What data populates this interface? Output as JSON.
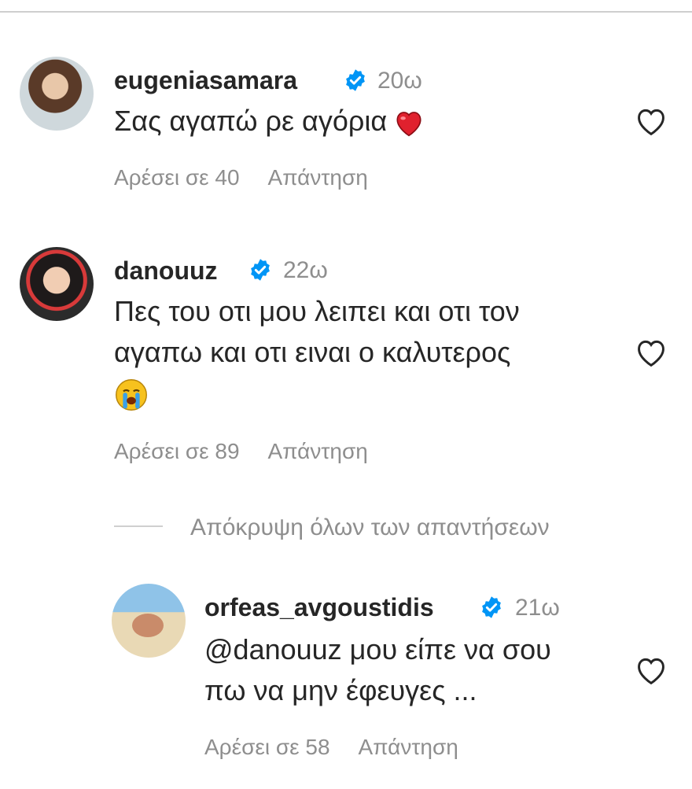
{
  "comments": [
    {
      "username": "eugeniasamara",
      "time": "20ω",
      "text": "Σας αγαπώ ρε αγόρια",
      "emoji": "red-heart",
      "likes_label": "Αρέσει σε 40",
      "reply_label": "Απάντηση"
    },
    {
      "username": "danouuz",
      "time": "22ω",
      "text_lines": [
        "Πες του οτι μου λειπει και οτι τον",
        "αγαπω και οτι ειναι ο καλυτερος"
      ],
      "emoji": "loudly-crying-face",
      "likes_label": "Αρέσει σε 89",
      "reply_label": "Απάντηση"
    }
  ],
  "hide_replies_label": "Απόκρυψη όλων των απαντήσεων",
  "reply": {
    "username": "orfeas_avgoustidis",
    "time": "21ω",
    "text_lines": [
      "@danouuz μου είπε να σου",
      "πω να μην έφευγες ..."
    ],
    "likes_label": "Αρέσει σε 58",
    "reply_label": "Απάντηση"
  },
  "colors": {
    "verified_blue": "#0095f6",
    "secondary_text": "#8e8e8e",
    "primary_text": "#262626"
  },
  "icons": {
    "like": "heart-outline-icon",
    "verified": "verified-badge-icon"
  }
}
